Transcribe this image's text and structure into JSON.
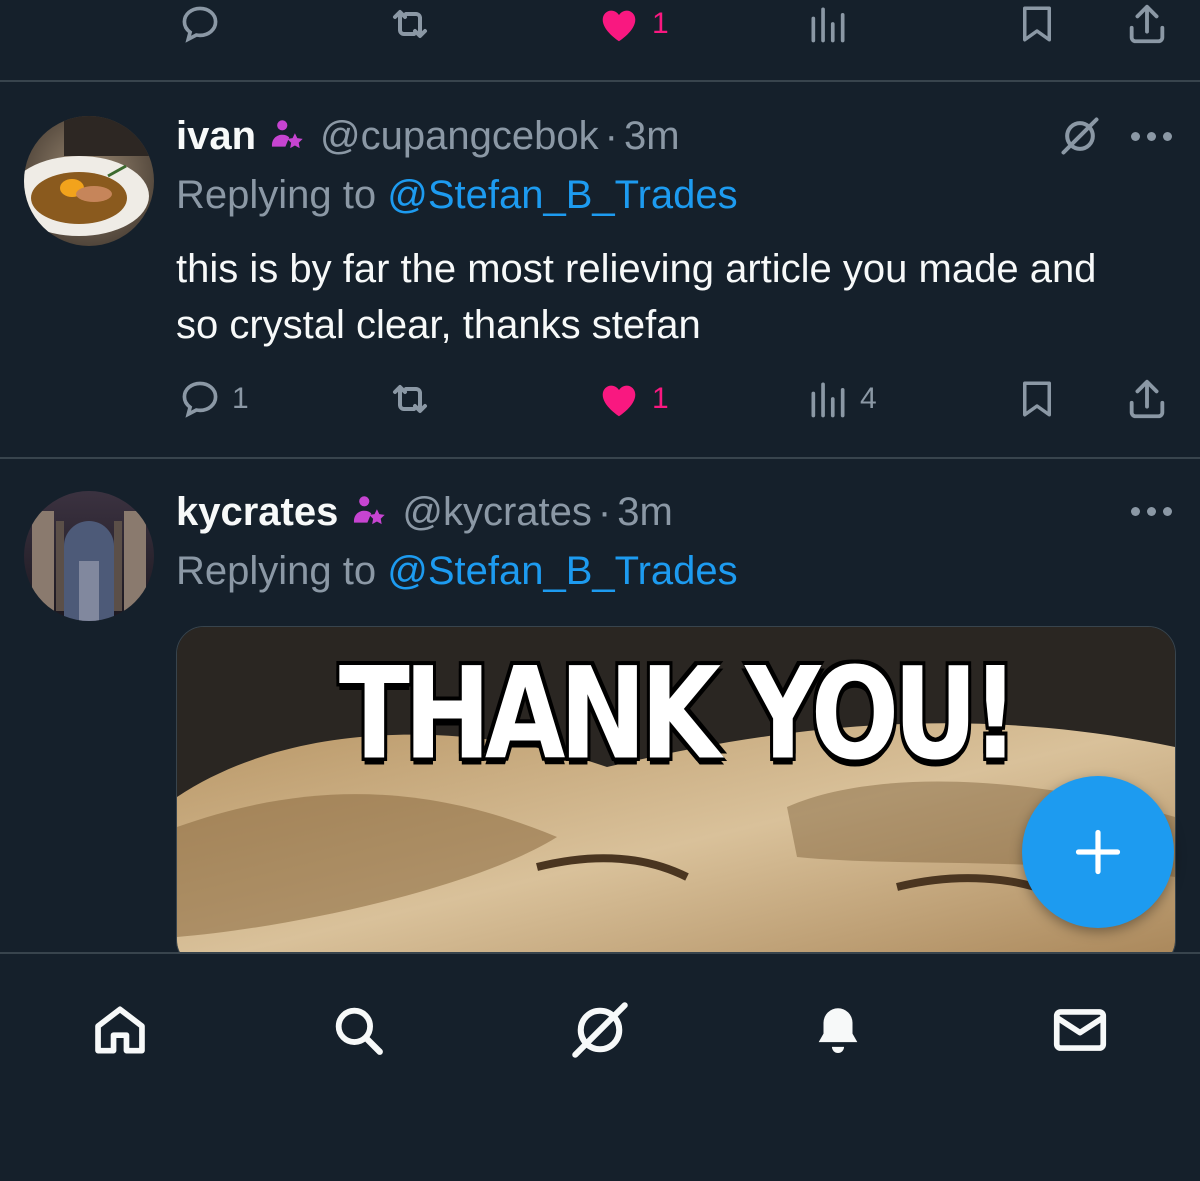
{
  "colors": {
    "background": "#15202b",
    "divider": "#38444d",
    "muted": "#8b98a5",
    "link": "#1d9bf0",
    "like": "#f91880",
    "badge": "#c644d1",
    "fab": "#1d9bf0"
  },
  "top_actions": {
    "reply": {
      "icon": "reply-icon",
      "count": ""
    },
    "retweet": {
      "icon": "retweet-icon",
      "count": ""
    },
    "like": {
      "icon": "heart-filled-icon",
      "count": "1"
    },
    "views": {
      "icon": "views-icon",
      "count": ""
    },
    "bookmark": {
      "icon": "bookmark-icon"
    },
    "share": {
      "icon": "share-icon"
    }
  },
  "tweets": [
    {
      "name": "ivan",
      "handle": "@cupangcebok",
      "separator": "·",
      "time": "3m",
      "replying_prefix": "Replying to ",
      "replying_to": "@Stefan_B_Trades",
      "text": "this is by far the most relieving article you made and so crystal clear, thanks stefan",
      "badge_icon": "affiliate-badge-icon",
      "extra_icon": "grok-icon",
      "actions": {
        "reply_count": "1",
        "retweet_count": "",
        "like_count": "1",
        "views_count": "4"
      }
    },
    {
      "name": "kycrates",
      "handle": "@kycrates",
      "separator": "·",
      "time": "3m",
      "replying_prefix": "Replying to ",
      "replying_to": "@Stefan_B_Trades",
      "badge_icon": "affiliate-badge-icon",
      "media": {
        "type": "gif",
        "caption": "THANK YOU!"
      }
    }
  ],
  "fab": {
    "icon": "plus-icon"
  },
  "bottom_nav": [
    {
      "id": "home",
      "icon": "home-icon"
    },
    {
      "id": "search",
      "icon": "search-icon"
    },
    {
      "id": "grok",
      "icon": "grok-icon"
    },
    {
      "id": "notifications",
      "icon": "bell-icon"
    },
    {
      "id": "messages",
      "icon": "mail-icon"
    }
  ]
}
